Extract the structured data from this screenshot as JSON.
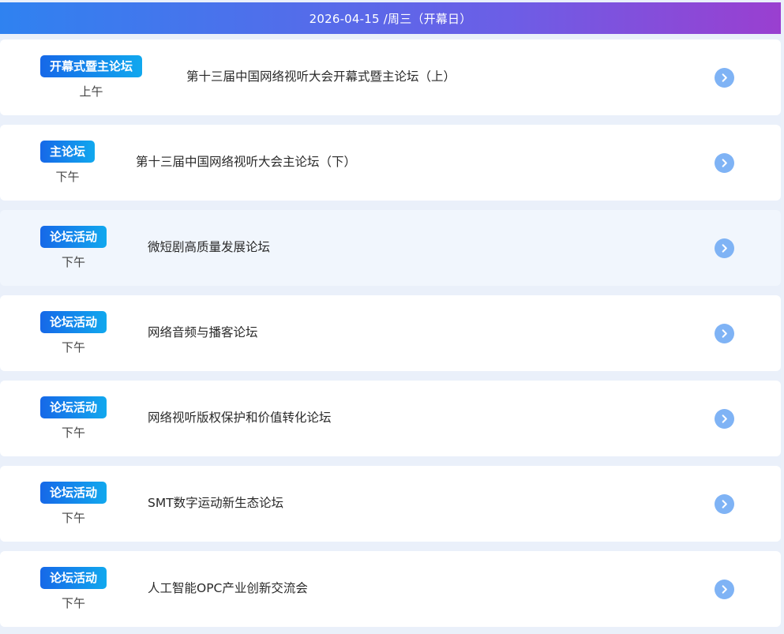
{
  "day_header": "2026-04-15 /周三（开幕日）",
  "sessions": [
    {
      "tag": "开幕式暨主论坛",
      "period": "上午",
      "title": "第十三届中国网络视听大会开幕式暨主论坛（上）"
    },
    {
      "tag": "主论坛",
      "period": "下午",
      "title": "第十三届中国网络视听大会主论坛（下）"
    },
    {
      "tag": "论坛活动",
      "period": "下午",
      "title": "微短剧高质量发展论坛"
    },
    {
      "tag": "论坛活动",
      "period": "下午",
      "title": "网络音频与播客论坛"
    },
    {
      "tag": "论坛活动",
      "period": "下午",
      "title": "网络视听版权保护和价值转化论坛"
    },
    {
      "tag": "论坛活动",
      "period": "下午",
      "title": "SMT数字运动新生态论坛"
    },
    {
      "tag": "论坛活动",
      "period": "下午",
      "title": "人工智能OPC产业创新交流会"
    }
  ],
  "icons": {
    "row_arrow": "chevron-right-circle-icon"
  },
  "colors": {
    "header_gradient_start": "#2f82f0",
    "header_gradient_end": "#9a3fd0",
    "tag_gradient_start": "#1668e8",
    "tag_gradient_end": "#11a8ee",
    "arrow_circle": "#7fb3f5",
    "page_background": "#eaf0fa"
  }
}
